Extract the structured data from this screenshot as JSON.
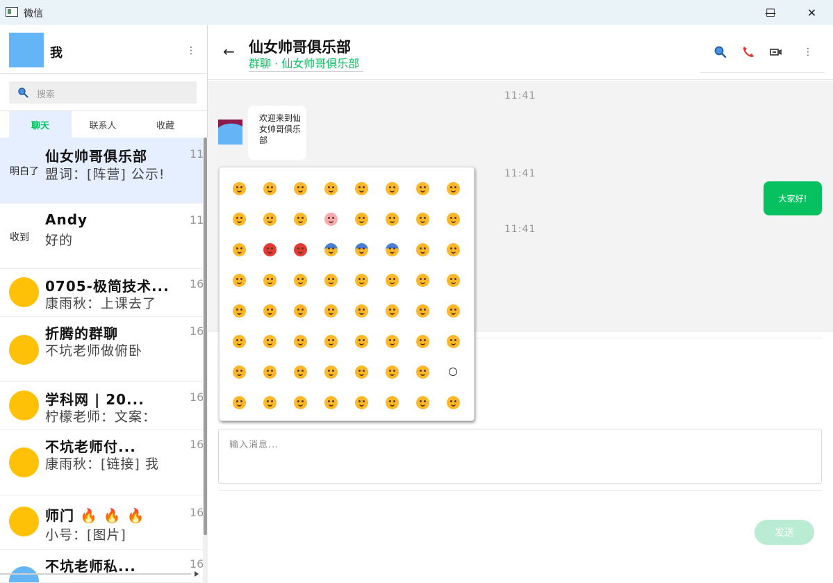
{
  "window": {
    "title": "微信",
    "minimize_glyph": "—",
    "maximize_glyph": "☐",
    "close_glyph": "✕"
  },
  "profile": {
    "name": "我",
    "menu_glyph": "⋮"
  },
  "search": {
    "placeholder": "搜索"
  },
  "tabs": [
    {
      "label": "聊天",
      "active": true
    },
    {
      "label": "联系人",
      "active": false
    },
    {
      "label": "收藏",
      "active": false
    }
  ],
  "chats": [
    {
      "left_text": "明白了",
      "name": "仙女帅哥俱乐部",
      "preview": "盟词：[阵营] 公示!",
      "time": "11",
      "selected": true
    },
    {
      "left_text": "收到",
      "name": "Andy",
      "preview": "好的",
      "time": "11",
      "selected": false
    },
    {
      "left_text": "",
      "name": "0705-极简技术...",
      "preview": "康雨秋：上课去了",
      "time": "16",
      "selected": false
    },
    {
      "left_text": "",
      "name": "折腾的群聊",
      "preview": "不坑老师做俯卧",
      "time": "16",
      "selected": false
    },
    {
      "left_text": "",
      "name": "学科网 | 20...",
      "preview": "柠檬老师：文案：",
      "time": "16",
      "selected": false
    },
    {
      "left_text": "",
      "name": "不坑老师付...",
      "preview": "康雨秋：[链接] 我",
      "time": "16",
      "selected": false
    },
    {
      "left_text": "",
      "name": "师门 🔥 🔥 🔥",
      "preview": "小号：[图片]",
      "time": "16",
      "selected": false
    },
    {
      "left_text": "",
      "name": "不坑老师私...",
      "preview": "",
      "time": "16",
      "selected": false
    }
  ],
  "conversation": {
    "back_glyph": "←",
    "title": "仙女帅哥俱乐部",
    "subtitle": "群聊 · 仙女帅哥俱乐部",
    "menu_glyph": "⋮",
    "timestamps": [
      "11:41",
      "11:41",
      "11:41"
    ],
    "incoming_message": "欢迎来到仙女帅哥俱乐部",
    "outgoing_message": "大家好!"
  },
  "composer": {
    "placeholder": "输入消息...",
    "send_label": "发送"
  },
  "emoji_picker": {
    "rows": 8,
    "cols": 8,
    "accent_colors": {
      "yellow": "#fdb82a",
      "red": "#e53935",
      "blue": "#4a7fd6"
    }
  },
  "colors": {
    "accent_green": "#07c160",
    "selected_bg": "#e6efff",
    "avatar_blue": "#64b5f6",
    "avatar_yellow": "#ffc107"
  }
}
